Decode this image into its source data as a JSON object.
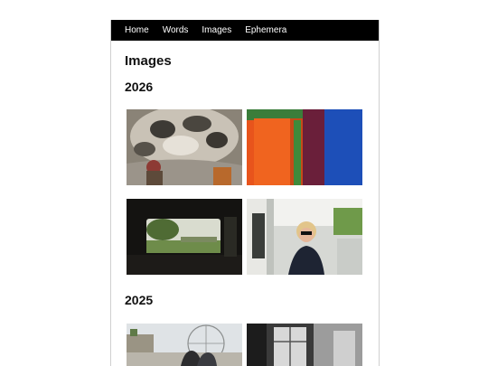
{
  "nav": {
    "items": [
      {
        "label": "Home"
      },
      {
        "label": "Words"
      },
      {
        "label": "Images"
      },
      {
        "label": "Ephemera"
      }
    ]
  },
  "page": {
    "title": "Images"
  },
  "sections": [
    {
      "year": "2026",
      "photos": [
        "photo-sculpture-dome",
        "photo-color-field-painting",
        "photo-car-window-park",
        "photo-person-in-truck"
      ]
    },
    {
      "year": "2025",
      "photos": [
        "photo-fortress-plaza",
        "photo-bw-window-room"
      ]
    }
  ]
}
